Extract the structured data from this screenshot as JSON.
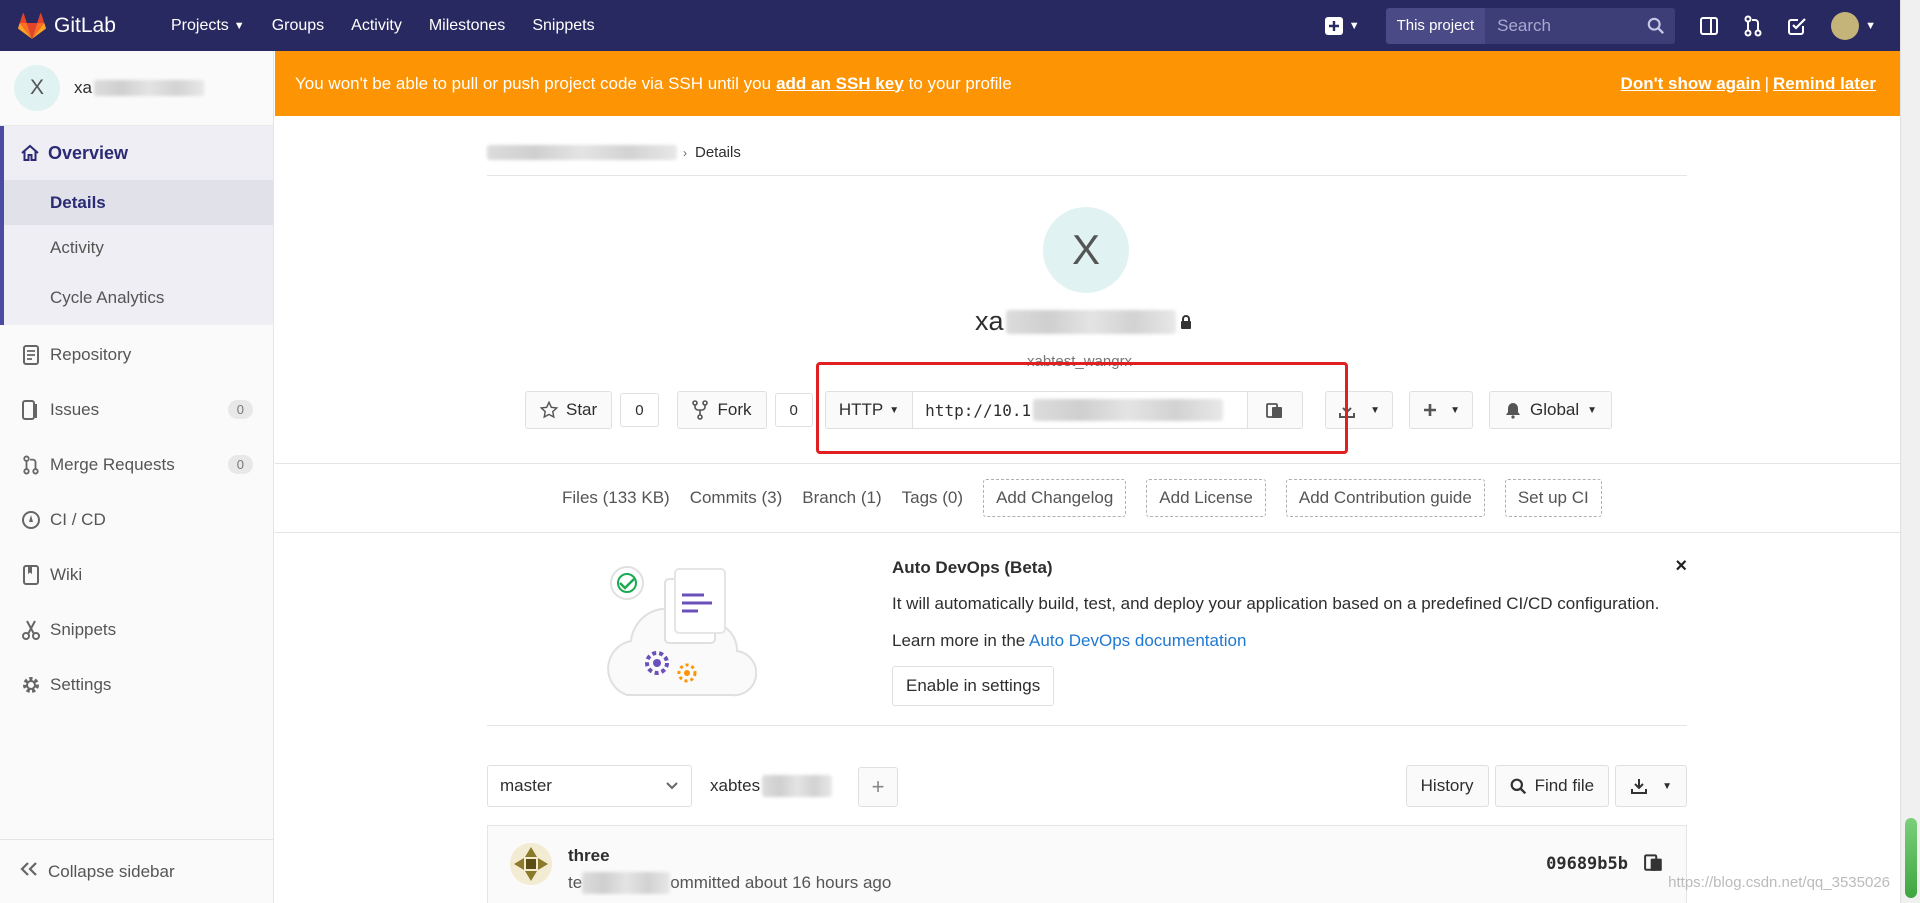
{
  "navbar": {
    "logo_text": "GitLab",
    "links": [
      {
        "label": "Projects",
        "has_dropdown": true
      },
      {
        "label": "Groups",
        "has_dropdown": false
      },
      {
        "label": "Activity",
        "has_dropdown": false
      },
      {
        "label": "Milestones",
        "has_dropdown": false
      },
      {
        "label": "Snippets",
        "has_dropdown": false
      }
    ],
    "search_scope": "This project",
    "search_placeholder": "Search"
  },
  "sidebar": {
    "project_initial": "X",
    "project_name_visible": "xa",
    "overview": "Overview",
    "overview_subitems": [
      "Details",
      "Activity",
      "Cycle Analytics"
    ],
    "items": [
      {
        "label": "Repository",
        "icon": "doc-icon"
      },
      {
        "label": "Issues",
        "icon": "issues-icon",
        "badge": "0"
      },
      {
        "label": "Merge Requests",
        "icon": "merge-request-icon",
        "badge": "0"
      },
      {
        "label": "CI / CD",
        "icon": "rocket-icon"
      },
      {
        "label": "Wiki",
        "icon": "book-icon"
      },
      {
        "label": "Snippets",
        "icon": "scissors-icon"
      },
      {
        "label": "Settings",
        "icon": "gear-icon"
      }
    ],
    "collapse_label": "Collapse sidebar"
  },
  "alert": {
    "text_before": "You won't be able to pull or push project code via SSH until you",
    "link": "add an SSH key",
    "text_after": "to your profile",
    "dont_show": "Don't show again",
    "separator": "|",
    "remind_later": "Remind later"
  },
  "breadcrumb": {
    "current": "Details"
  },
  "project": {
    "initial": "X",
    "title_visible": "xa",
    "subtitle": "xabtest_wangrx"
  },
  "actions": {
    "star_label": "Star",
    "star_count": "0",
    "fork_label": "Fork",
    "fork_count": "0",
    "protocol": "HTTP",
    "clone_url_visible": "http://10.1",
    "notification": "Global"
  },
  "stats": {
    "files": "Files (133 KB)",
    "commits": "Commits (3)",
    "branch": "Branch (1)",
    "tags": "Tags (0)",
    "buttons": [
      "Add Changelog",
      "Add License",
      "Add Contribution guide",
      "Set up CI"
    ]
  },
  "devops": {
    "title": "Auto DevOps (Beta)",
    "text": "It will automatically build, test, and deploy your application based on a predefined CI/CD configuration.",
    "learn_prefix": "Learn more in the",
    "learn_link": "Auto DevOps documentation",
    "button": "Enable in settings",
    "close": "×"
  },
  "tree": {
    "branch": "master",
    "path_visible": "xabtes",
    "plus": "+",
    "history": "History",
    "find_file": "Find file"
  },
  "commit": {
    "title_visible": "three",
    "author_visible": "te",
    "meta_suffix": "ommitted about 16 hours ago",
    "sha": "09689b5b"
  },
  "watermark": "https://blog.csdn.net/qq_3535026"
}
